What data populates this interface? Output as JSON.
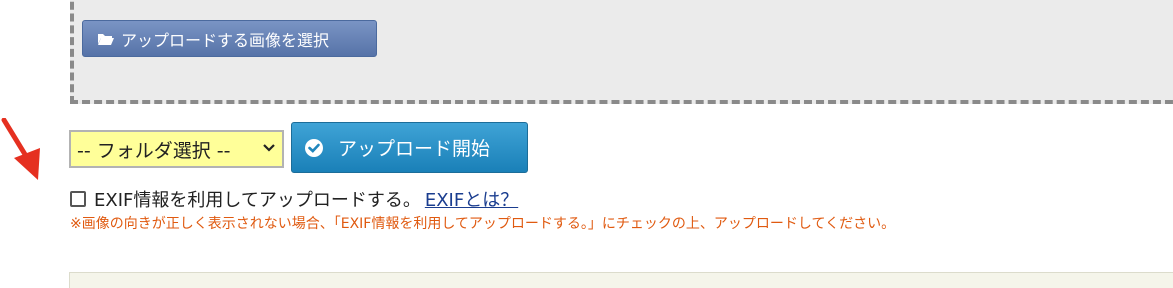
{
  "upload_area": {
    "select_button_label": "アップロードする画像を選択"
  },
  "controls": {
    "folder_select_value": "-- フォルダ選択 --",
    "upload_button_label": "アップロード開始"
  },
  "exif": {
    "checkbox_label": "EXIF情報を利用してアップロードする。",
    "link_label": "EXIFとは？",
    "checked": false
  },
  "note_text": "※画像の向きが正しく表示されない場合、「EXIF情報を利用してアップロードする。」にチェックの上、アップロードしてください。",
  "colors": {
    "select_button": "#5f7cb2",
    "upload_button": "#2a8fc6",
    "folder_select_bg": "#ffff99",
    "note": "#e05a10",
    "link": "#1a3d8f",
    "arrow": "#e53020"
  }
}
